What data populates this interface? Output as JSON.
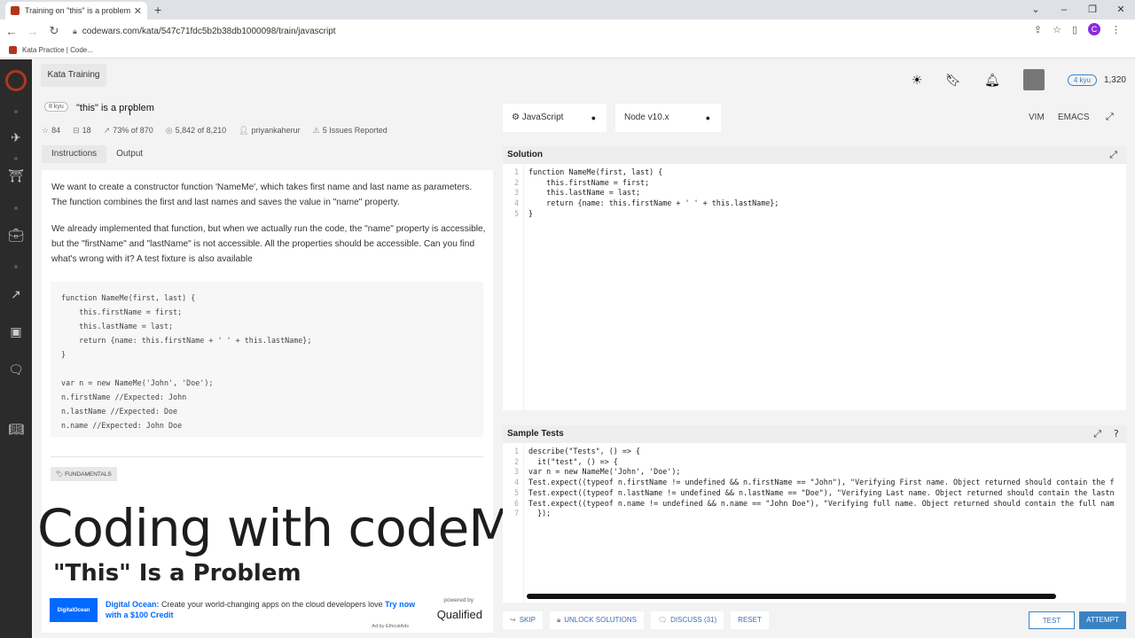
{
  "browser": {
    "tab_title": "Training on \"this\" is a problem | C",
    "url": "codewars.com/kata/547c71fdc5b2b38db1000098/train/javascript",
    "bookmark": "Kata Practice | Code...",
    "profile_initial": "C"
  },
  "header": {
    "kata_training_tab": "Kata Training",
    "kyu_badge": "4 kyu",
    "honor": "1,320"
  },
  "kata": {
    "kyu": "8 kyu",
    "title": "\"this\" is a problem",
    "stats": {
      "stars": "84",
      "collections": "18",
      "satisfaction": "73% of 870",
      "completed": "5,842 of 8,210",
      "author": "priyankaherur",
      "issues": "5 Issues Reported"
    },
    "tabs": [
      "Instructions",
      "Output"
    ],
    "paragraph1": "We want to create a constructor function 'NameMe', which takes first name and last name as parameters. The function combines the first and last names and saves the value in \"name\" property.",
    "paragraph2": "We already implemented that function, but when we actually run the code, the \"name\" property is accessible, but the \"firstName\" and \"lastName\" is not accessible. All the properties should be accessible. Can you find what's wrong with it? A test fixture is also available",
    "example_code": [
      "function NameMe(first, last) {",
      "    this.firstName = first;",
      "    this.lastName = last;",
      "    return {name: this.firstName + ' ' + this.lastName};",
      "}",
      "",
      "var n = new NameMe('John', 'Doe');",
      "n.firstName //Expected: John",
      "n.lastName //Expected: Doe",
      "n.name //Expected: John Doe"
    ],
    "tag": "FUNDAMENTALS"
  },
  "overlay": {
    "title": "Coding with codeManS",
    "subtitle": "\"This\" Is a Problem"
  },
  "ad": {
    "logo_text": "DigitalOcean",
    "brand": "Digital Ocean:",
    "text": " Create your world-changing apps on the cloud developers love ",
    "cta": "Try now with a $100 Credit",
    "powered_by": "powered by",
    "qualified": "Qualified",
    "ethical": "Ad by EthicalAds"
  },
  "editor": {
    "language": "JavaScript",
    "version": "Node v10.x",
    "mode_vim": "VIM",
    "mode_emacs": "EMACS",
    "solution_label": "Solution",
    "solution_code": [
      "function NameMe(first, last) {",
      "    this.firstName = first;",
      "    this.lastName = last;",
      "    return {name: this.firstName + ' ' + this.lastName};",
      "}"
    ],
    "solution_line_numbers": [
      "1",
      "2",
      "3",
      "4",
      "5"
    ],
    "tests_label": "Sample Tests",
    "tests_code": [
      "describe(\"Tests\", () => {",
      "  it(\"test\", () => {",
      "var n = new NameMe('John', 'Doe');",
      "Test.expect((typeof n.firstName != undefined && n.firstName == \"John\"), \"Verifying First name. Object returned should contain the f",
      "Test.expect((typeof n.lastName != undefined && n.lastName == \"Doe\"), \"Verifying Last name. Object returned should contain the lastn",
      "Test.expect((typeof n.name != undefined && n.name == \"John Doe\"), \"Verifying full name. Object returned should contain the full nam",
      "  });"
    ],
    "tests_line_numbers": [
      "1",
      "2",
      "3",
      "4",
      "5",
      "6",
      "7"
    ]
  },
  "footer": {
    "skip": "SKIP",
    "unlock": "UNLOCK SOLUTIONS",
    "discuss": "DISCUSS (31)",
    "reset": "RESET",
    "test": "TEST",
    "attempt": "ATTEMPT"
  }
}
